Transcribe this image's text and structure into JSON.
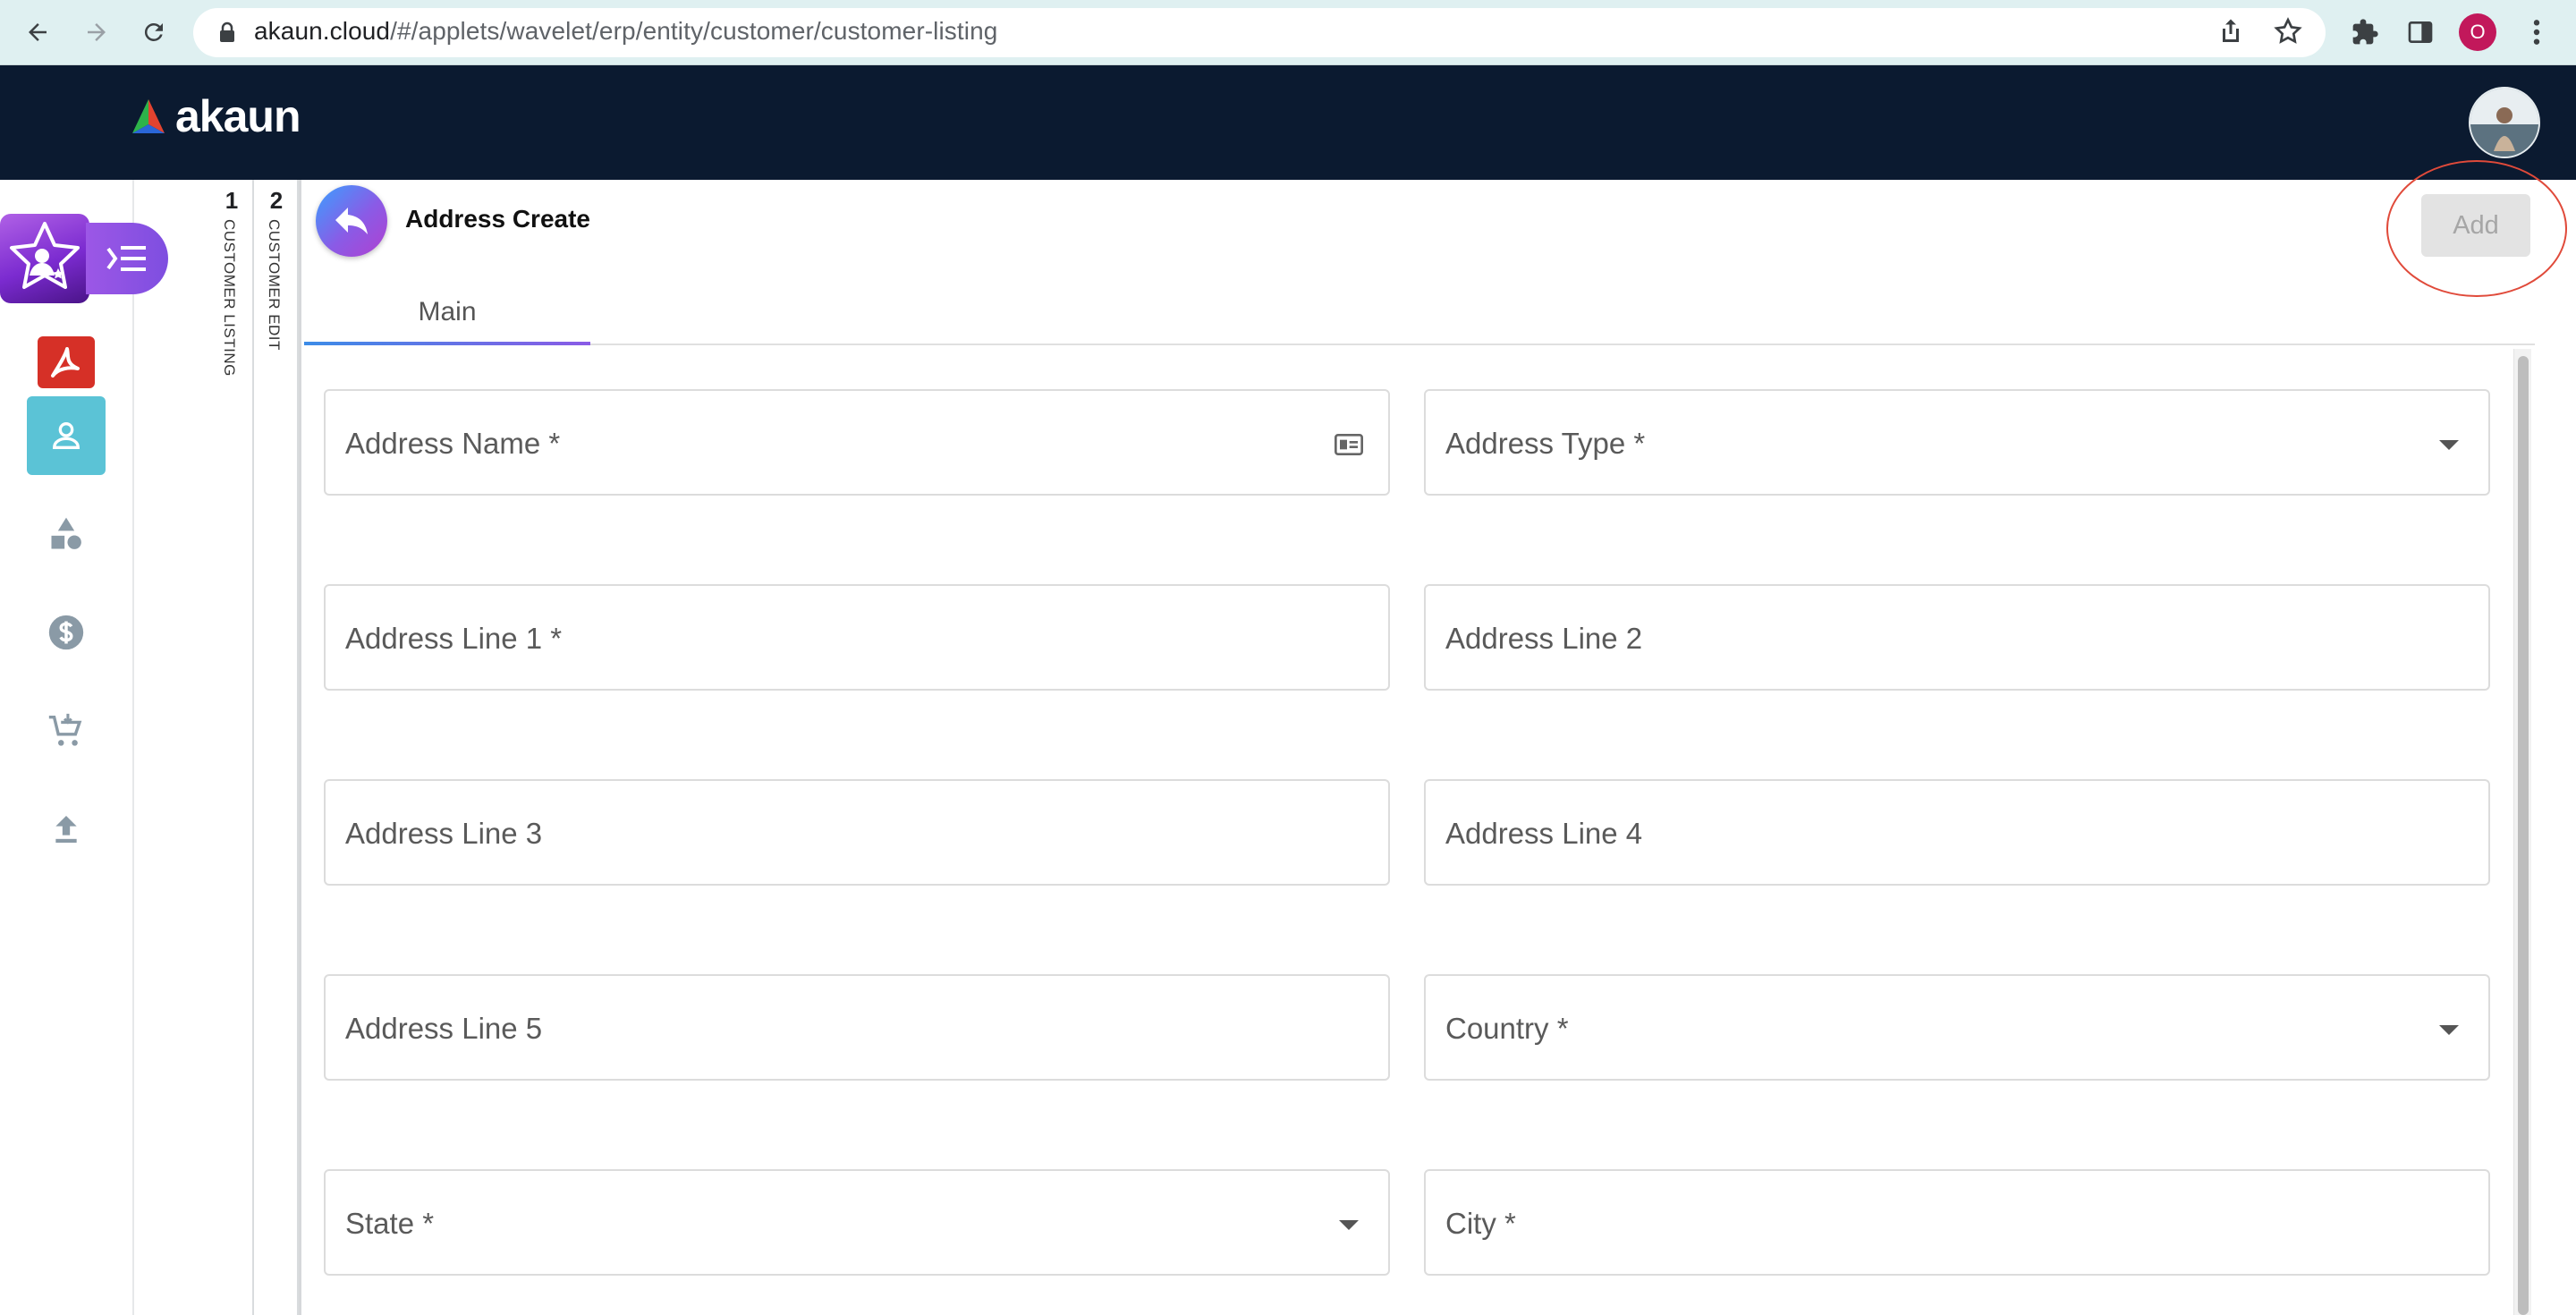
{
  "browser": {
    "url_host": "akaun.cloud",
    "url_path": "/#/applets/wavelet/erp/entity/customer/customer-listing",
    "profile_initial": "O"
  },
  "app": {
    "logo_text": "akaun"
  },
  "sidebar": {
    "items": [
      {
        "name": "applet-badge",
        "icon": "star-user-icon"
      },
      {
        "name": "menu-toggle",
        "icon": "menu-collapse-icon"
      },
      {
        "name": "pdf-app",
        "icon": "acrobat-icon"
      },
      {
        "name": "customer",
        "icon": "person-icon",
        "active": true
      },
      {
        "name": "shapes",
        "icon": "shapes-icon"
      },
      {
        "name": "pricing",
        "icon": "dollar-icon"
      },
      {
        "name": "cart",
        "icon": "cart-icon"
      },
      {
        "name": "upload",
        "icon": "upload-icon"
      }
    ]
  },
  "breadcrumbs": [
    {
      "index": "1",
      "label": "CUSTOMER LISTING"
    },
    {
      "index": "2",
      "label": "CUSTOMER EDIT"
    }
  ],
  "page": {
    "title": "Address Create",
    "add_label": "Add",
    "tabs": [
      {
        "label": "Main",
        "active": true
      }
    ]
  },
  "form": {
    "address_name": "Address Name *",
    "address_type": "Address Type *",
    "address_line_1": "Address Line 1 *",
    "address_line_2": "Address Line 2",
    "address_line_3": "Address Line 3",
    "address_line_4": "Address Line 4",
    "address_line_5": "Address Line 5",
    "country": "Country *",
    "state": "State *",
    "city": "City *"
  },
  "colors": {
    "header_bg": "#0b1a30",
    "active_sidebar": "#5bc3d6",
    "accent_purple": "#8a5be6",
    "annotation_red": "#e04a3a"
  }
}
